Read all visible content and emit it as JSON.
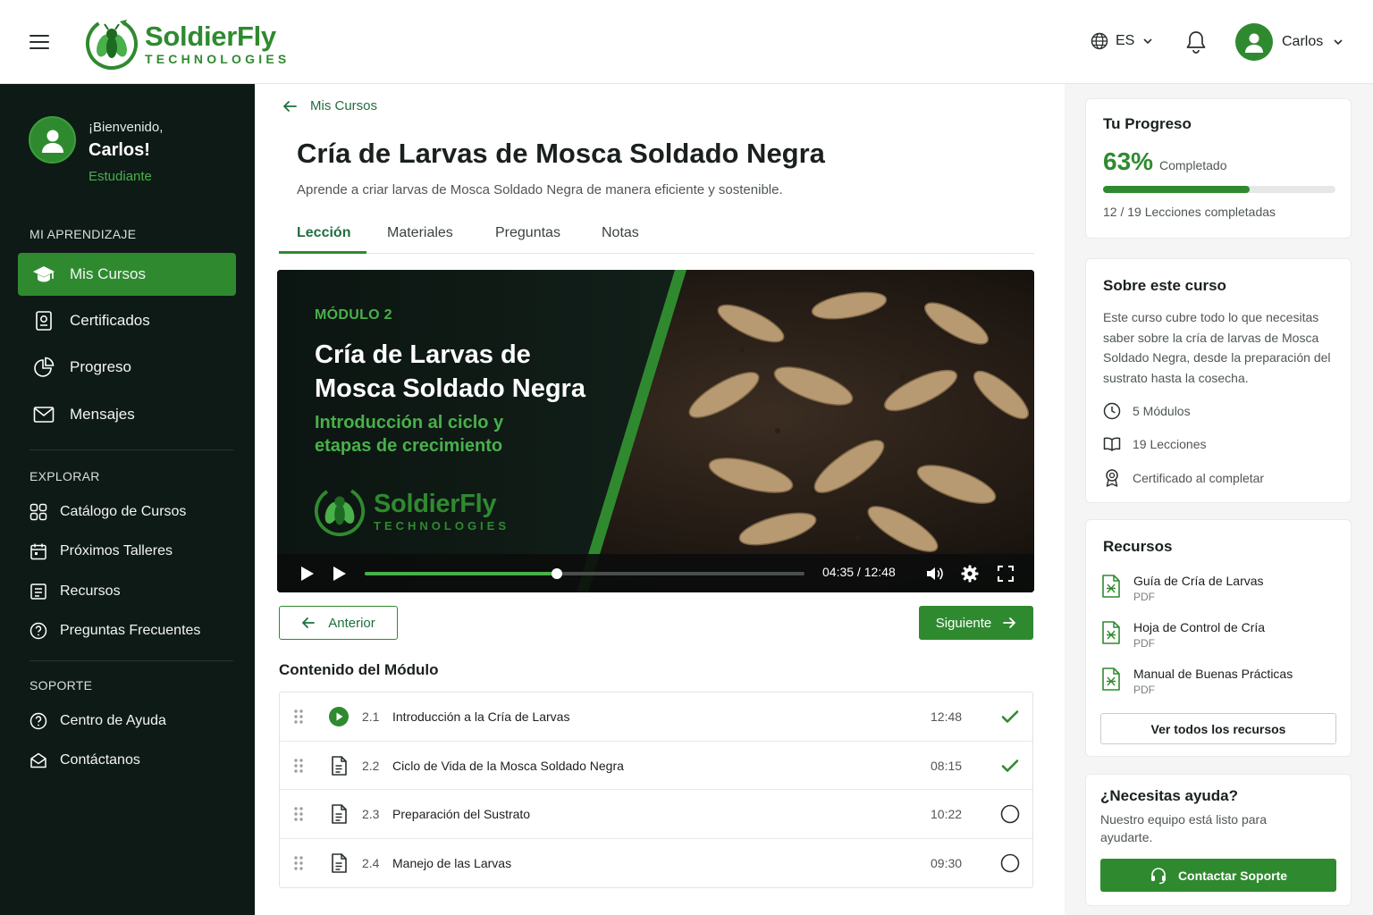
{
  "brand": {
    "name": "SoldierFly",
    "subtitle": "TECHNOLOGIES",
    "color": "#2f8a2f"
  },
  "header": {
    "menu_icon": "hamburger-icon",
    "language": "ES",
    "notifications_icon": "bell-icon",
    "user_name": "Carlos"
  },
  "sidebar": {
    "greeting": "¡Bienvenido,",
    "name": "Carlos!",
    "role": "Estudiante",
    "sections": {
      "learning": "MI APRENDIZAJE",
      "explore": "EXPLORAR",
      "support": "SOPORTE"
    },
    "learning_items": [
      {
        "label": "Mis Cursos",
        "icon": "graduation-cap-icon",
        "active": true
      },
      {
        "label": "Certificados",
        "icon": "certificate-icon"
      },
      {
        "label": "Progreso",
        "icon": "pie-chart-icon"
      },
      {
        "label": "Mensajes",
        "icon": "mail-icon"
      }
    ],
    "explore_items": [
      {
        "label": "Catálogo de Cursos",
        "icon": "grid-icon"
      },
      {
        "label": "Próximos Talleres",
        "icon": "calendar-icon"
      },
      {
        "label": "Recursos",
        "icon": "resources-icon"
      },
      {
        "label": "Preguntas Frecuentes",
        "icon": "question-icon"
      }
    ],
    "support_items": [
      {
        "label": "Centro de Ayuda",
        "icon": "help-circle-icon"
      },
      {
        "label": "Contáctanos",
        "icon": "envelope-open-icon"
      }
    ]
  },
  "main": {
    "back_label": "Mis Cursos",
    "title": "Cría de Larvas de Mosca Soldado Negra",
    "subtitle": "Aprende a criar larvas de Mosca Soldado Negra de manera eficiente y sostenible.",
    "tabs": [
      "Lección",
      "Materiales",
      "Preguntas",
      "Notas"
    ],
    "active_tab": "Lección",
    "video": {
      "module": "MÓDULO 2",
      "title": "Cría de Larvas de Mosca Soldado Negra",
      "subtitle": "Introducción al ciclo y etapas de crecimiento",
      "time": "04:35 / 12:48",
      "progress_fraction": 0.437
    },
    "prev_label": "Anterior",
    "next_label": "Siguiente",
    "module_heading": "Contenido del Módulo",
    "lessons": [
      {
        "num": "2.1",
        "title": "Introducción a la Cría de Larvas",
        "duration": "12:48",
        "kind": "video",
        "status": "completed"
      },
      {
        "num": "2.2",
        "title": "Ciclo de Vida de la Mosca Soldado Negra",
        "duration": "08:15",
        "kind": "document",
        "status": "completed"
      },
      {
        "num": "2.3",
        "title": "Preparación del Sustrato",
        "duration": "10:22",
        "kind": "document",
        "status": "pending"
      },
      {
        "num": "2.4",
        "title": "Manejo de las Larvas",
        "duration": "09:30",
        "kind": "document",
        "status": "pending"
      }
    ]
  },
  "progress": {
    "title": "Tu Progreso",
    "percent": "63%",
    "percent_value": 0.63,
    "label": "Completado",
    "count": "12 / 19 Lecciones completadas"
  },
  "about": {
    "title": "Sobre este curso",
    "text": "Este curso cubre todo lo que necesitas saber sobre la cría de larvas de Mosca Soldado Negra, desde la preparación del sustrato hasta la cosecha.",
    "modules": "5 Módulos",
    "lessons": "19 Lecciones",
    "certificate": "Certificado al completar"
  },
  "resources": {
    "title": "Recursos",
    "items": [
      {
        "title": "Guía de Cría de Larvas",
        "type": "PDF"
      },
      {
        "title": "Hoja de Control de Cría",
        "type": "PDF"
      },
      {
        "title": "Manual de Buenas Prácticas",
        "type": "PDF"
      }
    ],
    "view_all": "Ver todos los recursos"
  },
  "help": {
    "title": "¿Necesitas ayuda?",
    "text": "Nuestro equipo está listo para ayudarte.",
    "button": "Contactar Soporte"
  }
}
